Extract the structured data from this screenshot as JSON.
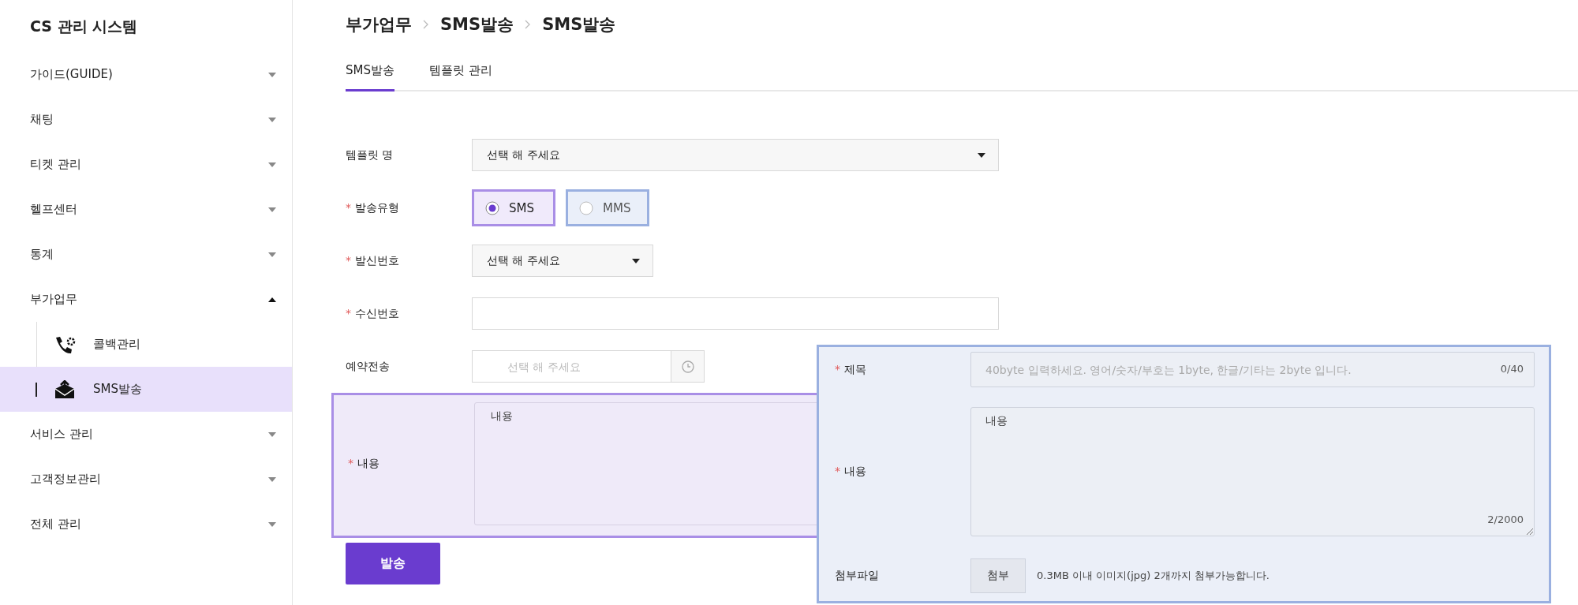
{
  "sidebar": {
    "title": "CS 관리 시스템",
    "items": [
      {
        "label": "가이드(GUIDE)",
        "expanded": false
      },
      {
        "label": "채팅",
        "expanded": false
      },
      {
        "label": "티켓 관리",
        "expanded": false
      },
      {
        "label": "헬프센터",
        "expanded": false
      },
      {
        "label": "통계",
        "expanded": false
      },
      {
        "label": "부가업무",
        "expanded": true,
        "children": [
          {
            "label": "콜백관리",
            "selected": false
          },
          {
            "label": "SMS발송",
            "selected": true
          }
        ]
      },
      {
        "label": "서비스 관리",
        "expanded": false
      },
      {
        "label": "고객정보관리",
        "expanded": false
      },
      {
        "label": "전체 관리",
        "expanded": false
      }
    ]
  },
  "breadcrumb": [
    "부가업무",
    "SMS발송",
    "SMS발송"
  ],
  "tabs": [
    {
      "label": "SMS발송",
      "selected": true
    },
    {
      "label": "템플릿 관리",
      "selected": false
    }
  ],
  "form": {
    "rows": [
      {
        "kind": "select",
        "label": "템플릿 명",
        "value": "선택 해 주세요"
      },
      {
        "kind": "radio",
        "label": "발송유형",
        "required_mark": "*",
        "options": [
          {
            "label": "SMS",
            "selected": true
          },
          {
            "label": "MMS",
            "selected": false
          }
        ]
      },
      {
        "kind": "short_select",
        "label": "발신번호",
        "required_mark": "*",
        "value": "선택 해 주세요"
      },
      {
        "kind": "input",
        "label": "수신번호",
        "required_mark": "*"
      },
      {
        "kind": "datetime",
        "label": "예약전송",
        "placeholder": "선택 해 주세요"
      },
      {
        "kind": "textarea",
        "label": "내용",
        "required_mark": "*",
        "value": "내용",
        "highlighted": true
      }
    ],
    "submit": "발송"
  },
  "mms_panel": {
    "rows": [
      {
        "kind": "counted_input",
        "label": "제목",
        "required_mark": "*",
        "placeholder": "40byte 입력하세요. 영어/숫자/부호는 1byte, 한글/기타는 2byte 입니다.",
        "counter": "0/40"
      },
      {
        "kind": "counted_textarea",
        "label": "내용",
        "required_mark": "*",
        "value": "내용",
        "counter": "2/2000"
      },
      {
        "kind": "attachment",
        "label": "첨부파일",
        "button": "첨부",
        "note": "0.3MB 이내 이미지(jpg) 2개까지 첨부가능합니다."
      }
    ]
  }
}
